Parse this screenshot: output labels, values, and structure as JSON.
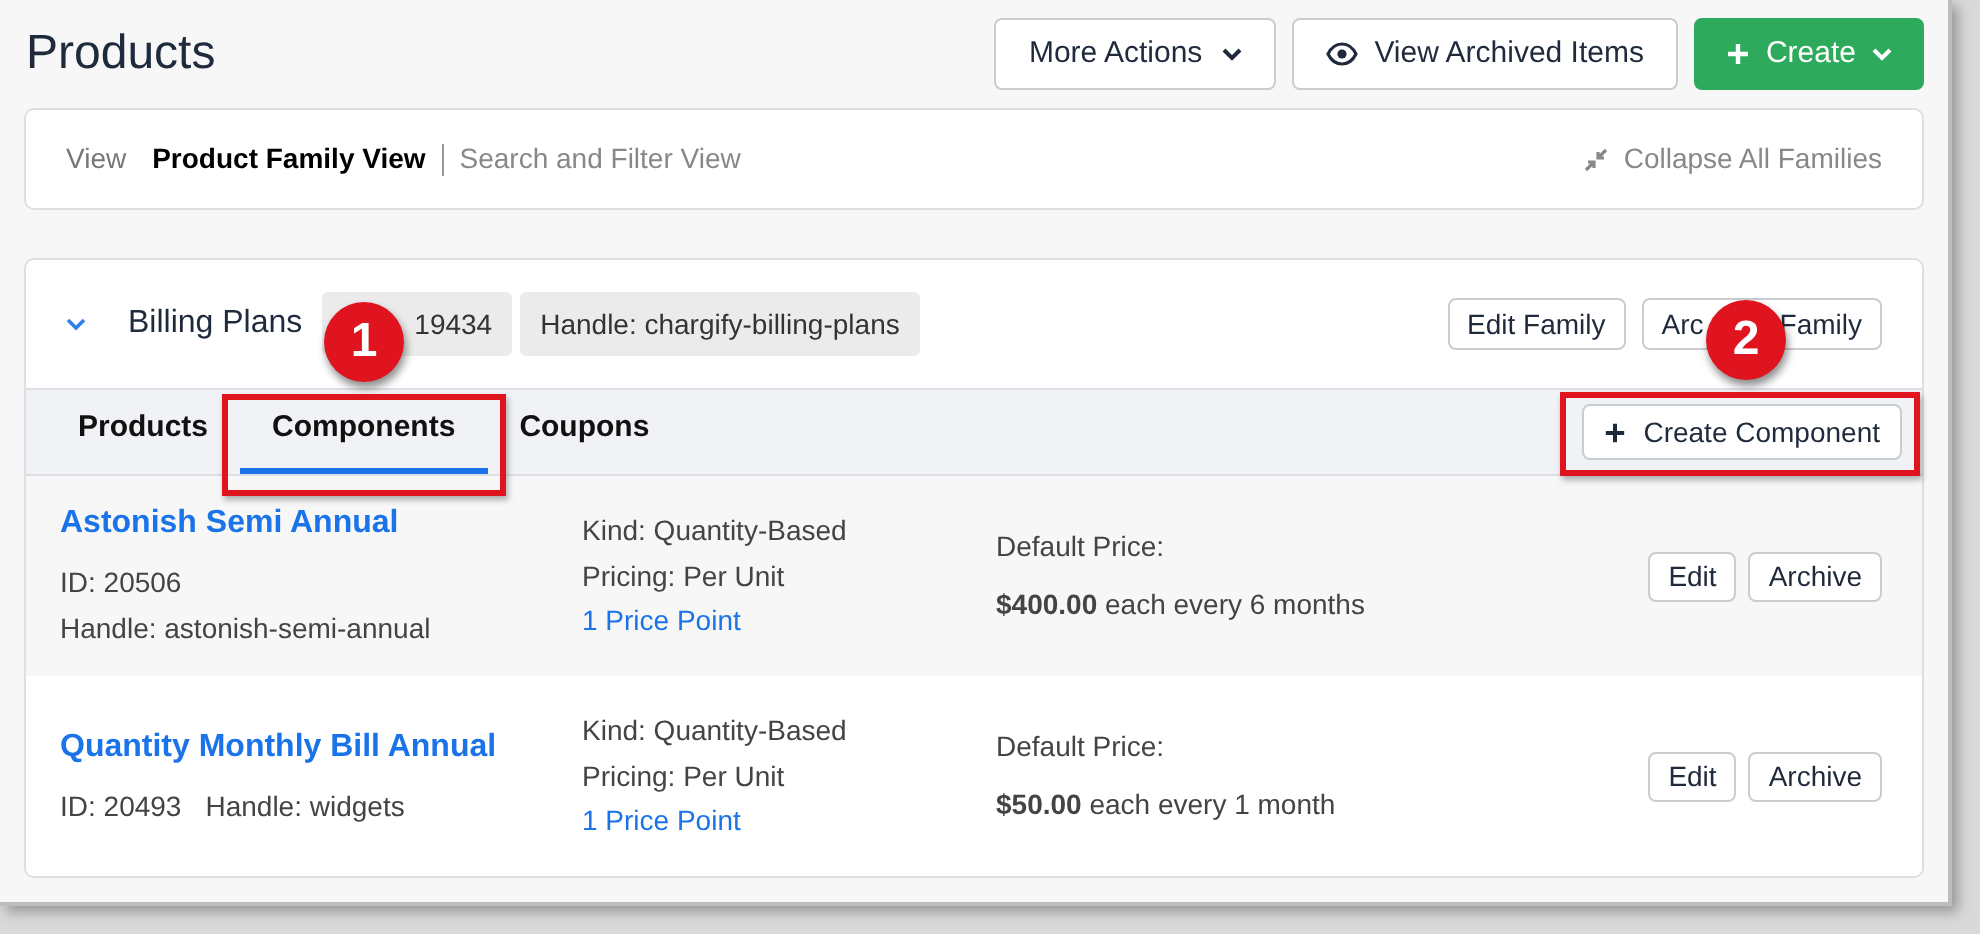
{
  "header": {
    "title": "Products",
    "buttons": [
      {
        "kind": "dropdown",
        "label": "More Actions"
      },
      {
        "kind": "eye",
        "label": "View Archived Items"
      },
      {
        "kind": "primary",
        "label": "Create"
      }
    ]
  },
  "view_bar": {
    "label": "View",
    "options": [
      {
        "label": "Product Family View",
        "selected": true
      },
      {
        "label": "Search and Filter View",
        "selected": false
      }
    ],
    "collapse": "Collapse All Families"
  },
  "family": {
    "expanded": true,
    "name": "Billing Plans",
    "id_chip": "19434",
    "handle_chip": "Handle: chargify-billing-plans",
    "edit_button": "Edit Family",
    "archive_button": {
      "label_start": "Arc",
      "label_end": "Family"
    },
    "tabs": [
      {
        "label": "Products",
        "selected": false
      },
      {
        "label": "Components",
        "selected": true
      },
      {
        "label": "Coupons",
        "selected": false
      }
    ],
    "create_button": "Create Component",
    "rows": [
      {
        "name": "Astonish Semi Annual",
        "id": "ID: 20506",
        "handle": "Handle: astonish-semi-annual",
        "kind": "Kind: Quantity-Based",
        "pricing": "Pricing: Per Unit",
        "price_points": "1 Price Point",
        "price_label": "Default Price:",
        "price": "**$400.00** each every 6 months",
        "buttons": [
          "Edit",
          "Archive"
        ]
      },
      {
        "name": "Quantity Monthly Bill Annual",
        "id": "ID: 20493",
        "handle": "Handle: widgets",
        "kind": "Kind: Quantity-Based",
        "pricing": "Pricing: Per Unit",
        "price_points": "1 Price Point",
        "price_label": "Default Price:",
        "price": "**$50.00** each every 1 month",
        "buttons": [
          "Edit",
          "Archive"
        ]
      }
    ]
  },
  "annotations": [
    {
      "number": "1"
    },
    {
      "number": "2"
    }
  ]
}
